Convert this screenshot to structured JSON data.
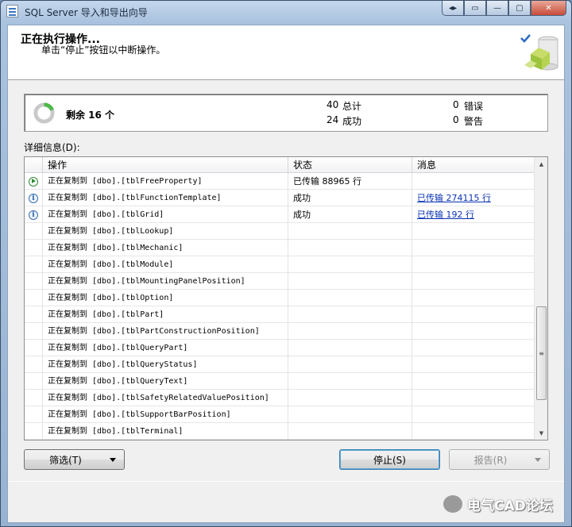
{
  "window": {
    "title": "SQL Server 导入和导出向导"
  },
  "header": {
    "title": "正在执行操作...",
    "subtitle": "单击“停止”按钮以中断操作。"
  },
  "summary": {
    "remaining": "剩余 16 个",
    "total_count": "40",
    "total_label": "总计",
    "success_count": "24",
    "success_label": "成功",
    "error_count": "0",
    "error_label": "错误",
    "warning_count": "0",
    "warning_label": "警告"
  },
  "details": {
    "label": "详细信息(D):",
    "columns": [
      "操作",
      "状态",
      "消息"
    ],
    "rows": [
      {
        "icon": "running-icon",
        "op": "正在复制到 [dbo].[tblFreeProperty]",
        "status": "已传输 88965 行",
        "message": ""
      },
      {
        "icon": "info-icon",
        "op": "正在复制到 [dbo].[tblFunctionTemplate]",
        "status": "成功",
        "message": "已传输 274115 行"
      },
      {
        "icon": "info-icon",
        "op": "正在复制到 [dbo].[tblGrid]",
        "status": "成功",
        "message": "已传输 192 行"
      },
      {
        "icon": "",
        "op": "正在复制到 [dbo].[tblLookup]",
        "status": "",
        "message": ""
      },
      {
        "icon": "",
        "op": "正在复制到 [dbo].[tblMechanic]",
        "status": "",
        "message": ""
      },
      {
        "icon": "",
        "op": "正在复制到 [dbo].[tblModule]",
        "status": "",
        "message": ""
      },
      {
        "icon": "",
        "op": "正在复制到 [dbo].[tblMountingPanelPosition]",
        "status": "",
        "message": ""
      },
      {
        "icon": "",
        "op": "正在复制到 [dbo].[tblOption]",
        "status": "",
        "message": ""
      },
      {
        "icon": "",
        "op": "正在复制到 [dbo].[tblPart]",
        "status": "",
        "message": ""
      },
      {
        "icon": "",
        "op": "正在复制到 [dbo].[tblPartConstructionPosition]",
        "status": "",
        "message": ""
      },
      {
        "icon": "",
        "op": "正在复制到 [dbo].[tblQueryPart]",
        "status": "",
        "message": ""
      },
      {
        "icon": "",
        "op": "正在复制到 [dbo].[tblQueryStatus]",
        "status": "",
        "message": ""
      },
      {
        "icon": "",
        "op": "正在复制到 [dbo].[tblQueryText]",
        "status": "",
        "message": ""
      },
      {
        "icon": "",
        "op": "正在复制到 [dbo].[tblSafetyRelatedValuePosition]",
        "status": "",
        "message": ""
      },
      {
        "icon": "",
        "op": "正在复制到 [dbo].[tblSupportBarPosition]",
        "status": "",
        "message": ""
      },
      {
        "icon": "",
        "op": "正在复制到 [dbo].[tblTerminal]",
        "status": "",
        "message": ""
      }
    ]
  },
  "buttons": {
    "filter": "筛选(T)",
    "stop": "停止(S)",
    "report": "报告(R)"
  },
  "watermark": "电气CAD论坛",
  "colors": {
    "link": "#0a32b4",
    "running": "#2f8a34",
    "info": "#3a6db3"
  }
}
